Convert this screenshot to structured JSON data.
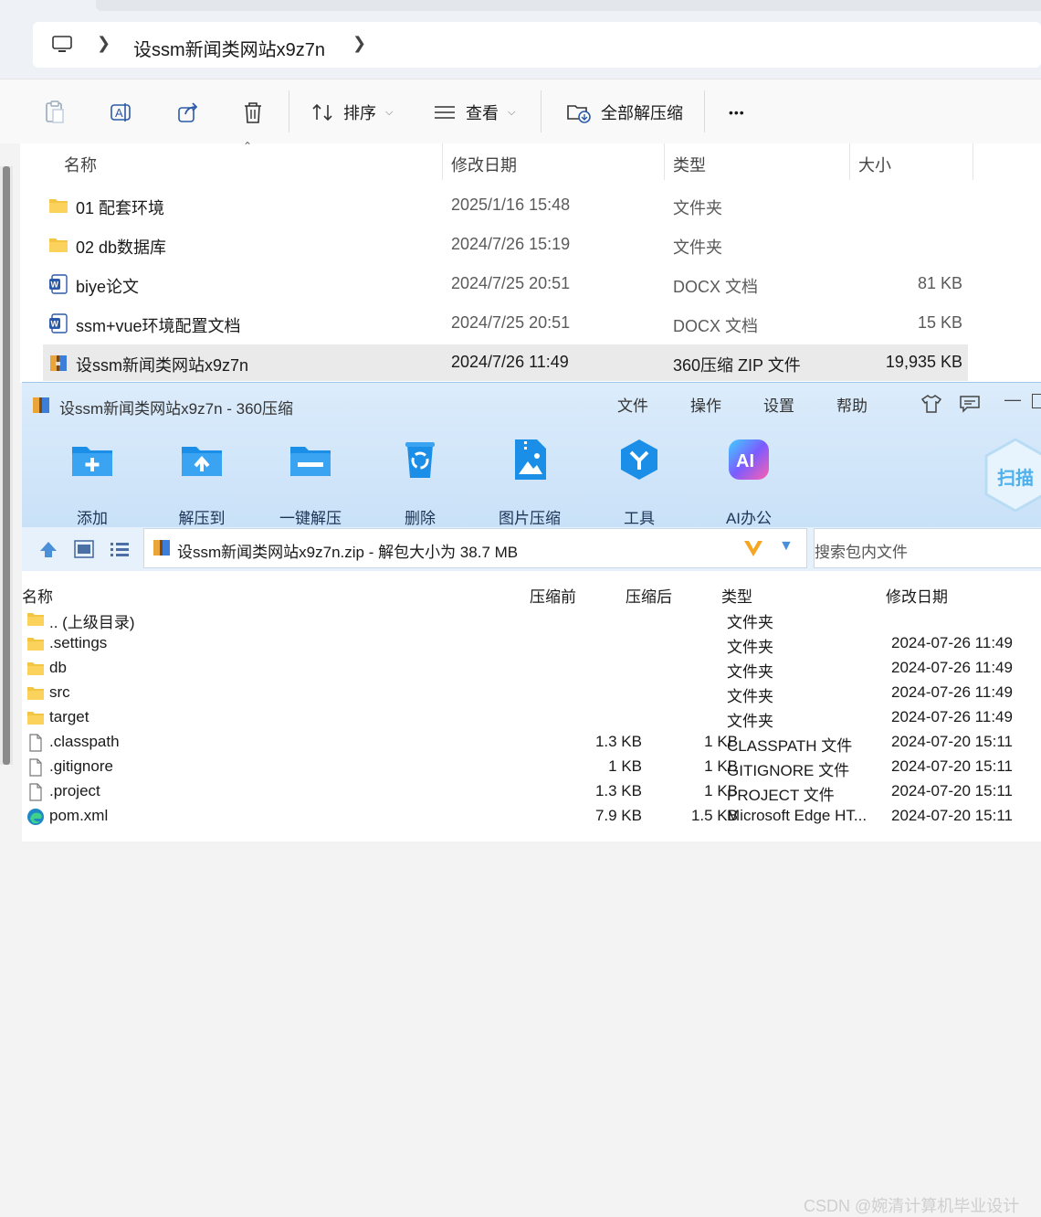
{
  "explorer": {
    "breadcrumb": [
      "设ssm新闻类网站x9z7n"
    ],
    "toolbar": {
      "sort_label": "排序",
      "view_label": "查看",
      "extract_all_label": "全部解压缩",
      "more_label": "•••"
    },
    "columns": {
      "name": "名称",
      "date": "修改日期",
      "type": "类型",
      "size": "大小"
    },
    "rows": [
      {
        "name": "01 配套环境",
        "date": "2025/1/16 15:48",
        "type": "文件夹",
        "size": "",
        "icon": "folder-icon"
      },
      {
        "name": "02 db数据库",
        "date": "2024/7/26 15:19",
        "type": "文件夹",
        "size": "",
        "icon": "folder-icon"
      },
      {
        "name": "biye论文",
        "date": "2024/7/25 20:51",
        "type": "DOCX 文档",
        "size": "81 KB",
        "icon": "word-doc-icon"
      },
      {
        "name": "ssm+vue环境配置文档",
        "date": "2024/7/25 20:51",
        "type": "DOCX 文档",
        "size": "15 KB",
        "icon": "word-doc-icon"
      },
      {
        "name": "设ssm新闻类网站x9z7n",
        "date": "2024/7/26 11:49",
        "type": "360压缩 ZIP 文件",
        "size": "19,935 KB",
        "icon": "zip-archive-icon",
        "selected": true
      }
    ]
  },
  "zip_app": {
    "title": "设ssm新闻类网站x9z7n - 360压缩",
    "menu": [
      "文件",
      "操作",
      "设置",
      "帮助"
    ],
    "ribbon": [
      {
        "label": "添加",
        "icon": "add-folder-icon"
      },
      {
        "label": "解压到",
        "icon": "extract-folder-icon"
      },
      {
        "label": "一键解压",
        "icon": "one-click-extract-icon"
      },
      {
        "label": "删除",
        "icon": "recycle-bin-icon"
      },
      {
        "label": "图片压缩",
        "icon": "image-compress-icon"
      },
      {
        "label": "工具",
        "icon": "tools-icon"
      },
      {
        "label": "AI办公",
        "icon": "ai-office-icon"
      }
    ],
    "scan_label": "扫描",
    "path_text": "设ssm新闻类网站x9z7n.zip - 解包大小为 38.7 MB",
    "search_placeholder": "搜索包内文件",
    "columns": {
      "name": "名称",
      "before": "压缩前",
      "after": "压缩后",
      "type": "类型",
      "date": "修改日期"
    },
    "rows": [
      {
        "name": ".. (上级目录)",
        "before": "",
        "after": "",
        "type": "文件夹",
        "date": "",
        "icon": "folder-icon"
      },
      {
        "name": ".settings",
        "before": "",
        "after": "",
        "type": "文件夹",
        "date": "2024-07-26 11:49",
        "icon": "folder-icon"
      },
      {
        "name": "db",
        "before": "",
        "after": "",
        "type": "文件夹",
        "date": "2024-07-26 11:49",
        "icon": "folder-icon"
      },
      {
        "name": "src",
        "before": "",
        "after": "",
        "type": "文件夹",
        "date": "2024-07-26 11:49",
        "icon": "folder-icon"
      },
      {
        "name": "target",
        "before": "",
        "after": "",
        "type": "文件夹",
        "date": "2024-07-26 11:49",
        "icon": "folder-icon"
      },
      {
        "name": ".classpath",
        "before": "1.3 KB",
        "after": "1 KB",
        "type": "CLASSPATH 文件",
        "date": "2024-07-20 15:11",
        "icon": "file-icon"
      },
      {
        "name": ".gitignore",
        "before": "1 KB",
        "after": "1 KB",
        "type": "GITIGNORE 文件",
        "date": "2024-07-20 15:11",
        "icon": "file-icon"
      },
      {
        "name": ".project",
        "before": "1.3 KB",
        "after": "1 KB",
        "type": "PROJECT 文件",
        "date": "2024-07-20 15:11",
        "icon": "file-icon"
      },
      {
        "name": "pom.xml",
        "before": "7.9 KB",
        "after": "1.5 KB",
        "type": "Microsoft Edge HT...",
        "date": "2024-07-20 15:11",
        "icon": "edge-icon"
      }
    ]
  },
  "watermark": "CSDN @婉清计算机毕业设计"
}
